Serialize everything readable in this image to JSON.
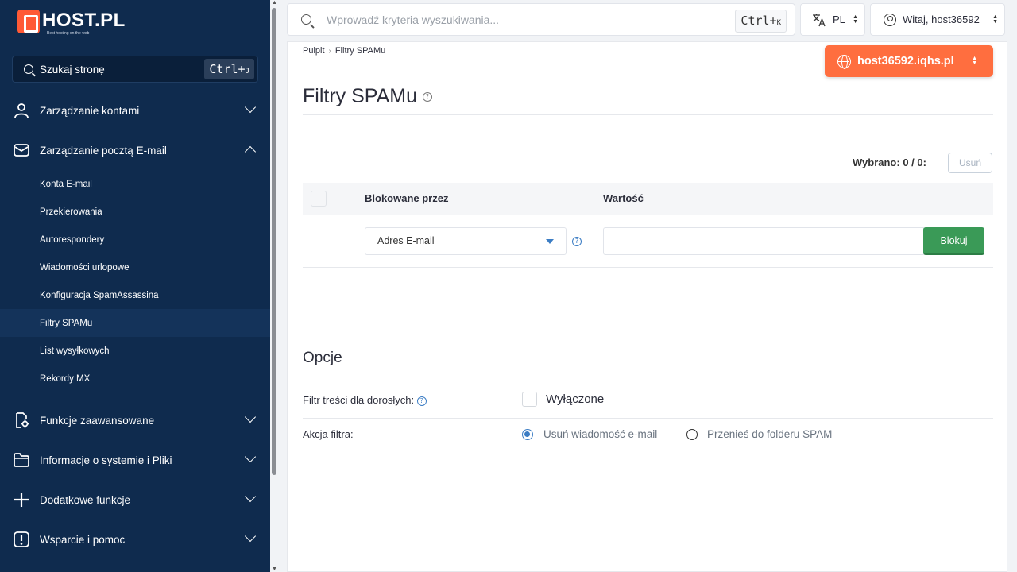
{
  "brand": {
    "name": "HOST.PL",
    "tagline": "Best hosting on the web"
  },
  "sidebar": {
    "search": {
      "label": "Szukaj stronę",
      "shortcut_main": "Ctrl+",
      "shortcut_key": "J"
    },
    "sections": [
      {
        "label": "Zarządzanie kontami",
        "icon": "user-icon",
        "expanded": false
      },
      {
        "label": "Zarządzanie pocztą E-mail",
        "icon": "mail-icon",
        "expanded": true
      },
      {
        "label": "Funkcje zaawansowane",
        "icon": "advanced-settings-icon",
        "expanded": false
      },
      {
        "label": "Informacje o systemie i Pliki",
        "icon": "folder-icon",
        "expanded": false
      },
      {
        "label": "Dodatkowe funkcje",
        "icon": "plus-icon",
        "expanded": false
      },
      {
        "label": "Wsparcie i pomoc",
        "icon": "alert-icon",
        "expanded": false
      }
    ],
    "email_items": [
      {
        "label": "Konta E-mail"
      },
      {
        "label": "Przekierowania"
      },
      {
        "label": "Autorespondery"
      },
      {
        "label": "Wiadomości urlopowe"
      },
      {
        "label": "Konfiguracja SpamAssassina"
      },
      {
        "label": "Filtry SPAMu",
        "active": true
      },
      {
        "label": "List wysyłkowych"
      },
      {
        "label": "Rekordy MX"
      }
    ]
  },
  "topbar": {
    "search_placeholder": "Wprowadź kryteria wyszukiwania...",
    "search_shortcut_main": "Ctrl+",
    "search_shortcut_key": "K",
    "language": "PL",
    "user_greeting": "Witaj, host36592"
  },
  "breadcrumb": {
    "home": "Pulpit",
    "current": "Filtry SPAMu"
  },
  "domain_selector": "host36592.iqhs.pl",
  "page": {
    "title": "Filtry SPAMu",
    "selected": "Wybrano: 0 / 0:",
    "delete_label": "Usuń"
  },
  "table": {
    "columns": [
      "Blokowane przez",
      "Wartość"
    ],
    "block_type_value": "Adres E-mail",
    "value_input": "",
    "block_button": "Blokuj"
  },
  "options": {
    "title": "Opcje",
    "adult_filter_label": "Filtr treści dla dorosłych:",
    "adult_filter_state": "Wyłączone",
    "adult_filter_checked": false,
    "action_label": "Akcja filtra:",
    "actions": [
      {
        "label": "Usuń wiadomość e-mail",
        "selected": true
      },
      {
        "label": "Przenieś do folderu SPAM",
        "selected": false
      }
    ]
  },
  "colors": {
    "sidebar_bg": "#0f2b4e",
    "accent_orange": "#ff6e3f",
    "accent_green": "#3a9a57",
    "accent_blue": "#3c7dc4"
  }
}
